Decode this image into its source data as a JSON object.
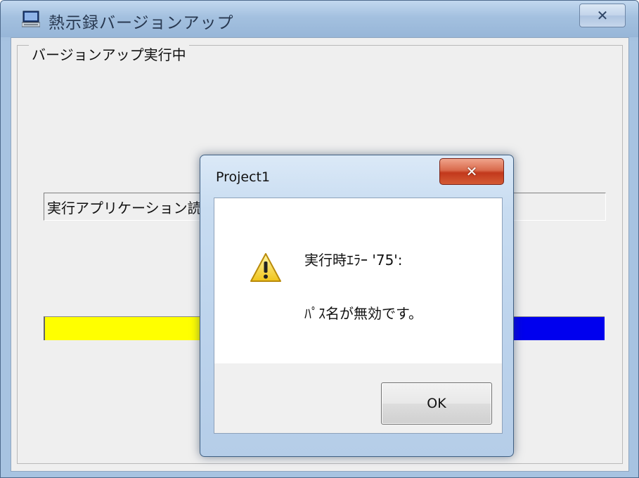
{
  "main_window": {
    "title": "熱示録バージョンアップ",
    "close_glyph": "✕",
    "icon": "computer-icon"
  },
  "frame": {
    "caption": "バージョンアップ実行中"
  },
  "status": {
    "text": "実行アプリケーション読"
  },
  "progress": {
    "fill_fraction": 0.24,
    "track_color": "#ffff00",
    "fill_color": "#0000ee"
  },
  "dialog": {
    "title": "Project1",
    "close_glyph": "✕",
    "icon": "warning-icon",
    "message_line1": "実行時ｴﾗｰ '75':",
    "message_line2": "ﾊﾟｽ名が無効です。",
    "ok_label": "OK"
  }
}
